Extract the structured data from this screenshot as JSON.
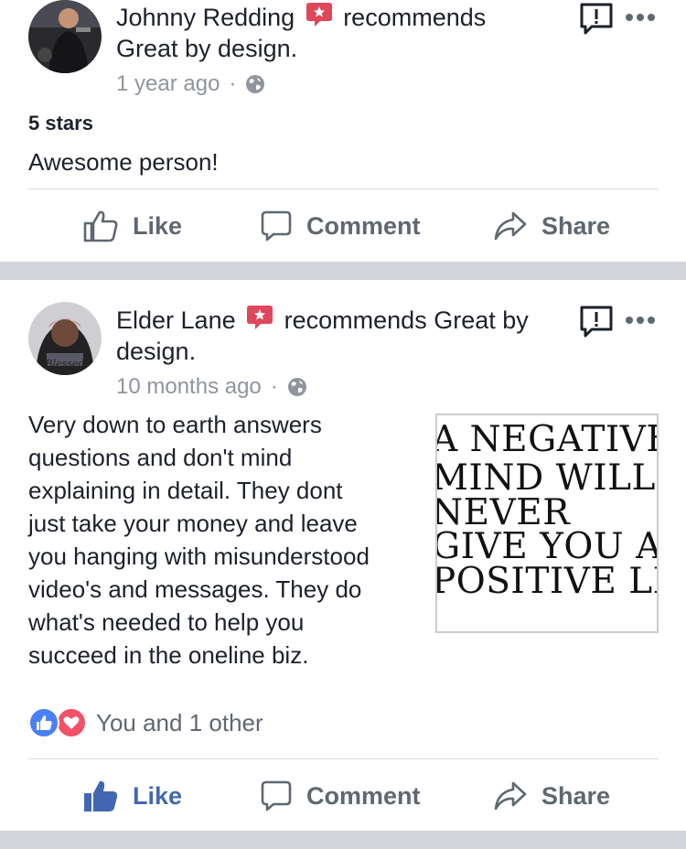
{
  "posts": [
    {
      "author": "Johnny Redding",
      "recommends_text": "recommends",
      "page_name": "Great by design.",
      "time": "1 year ago",
      "rating": "5 stars",
      "body": "Awesome person!",
      "actions": {
        "like": "Like",
        "comment": "Comment",
        "share": "Share"
      }
    },
    {
      "author": "Elder Lane",
      "recommends_text": "recommends Great by",
      "page_name": "design.",
      "time": "10 months ago",
      "body_lines": [
        "Very down to earth answers",
        "questions and don't mind",
        "explaining in detail. They dont",
        "just take your money and leave",
        "you hanging with misunderstood",
        "video's and messages. They do",
        "what's needed to help you",
        "succeed in the oneline biz."
      ],
      "image_text": [
        "A NEGATIVE",
        "MIND WILL",
        "NEVER",
        "GIVE YOU A",
        "POSITIVE LIFE"
      ],
      "avatar_caption": "Blessed",
      "reactions_text": "You and 1 other",
      "actions": {
        "like": "Like",
        "comment": "Comment",
        "share": "Share"
      }
    }
  ],
  "meta_separator": "·",
  "colors": {
    "like_blue": "#4267b2",
    "muted": "#90949c",
    "badge_red": "#e0475b",
    "separator": "#d2d5d9"
  }
}
